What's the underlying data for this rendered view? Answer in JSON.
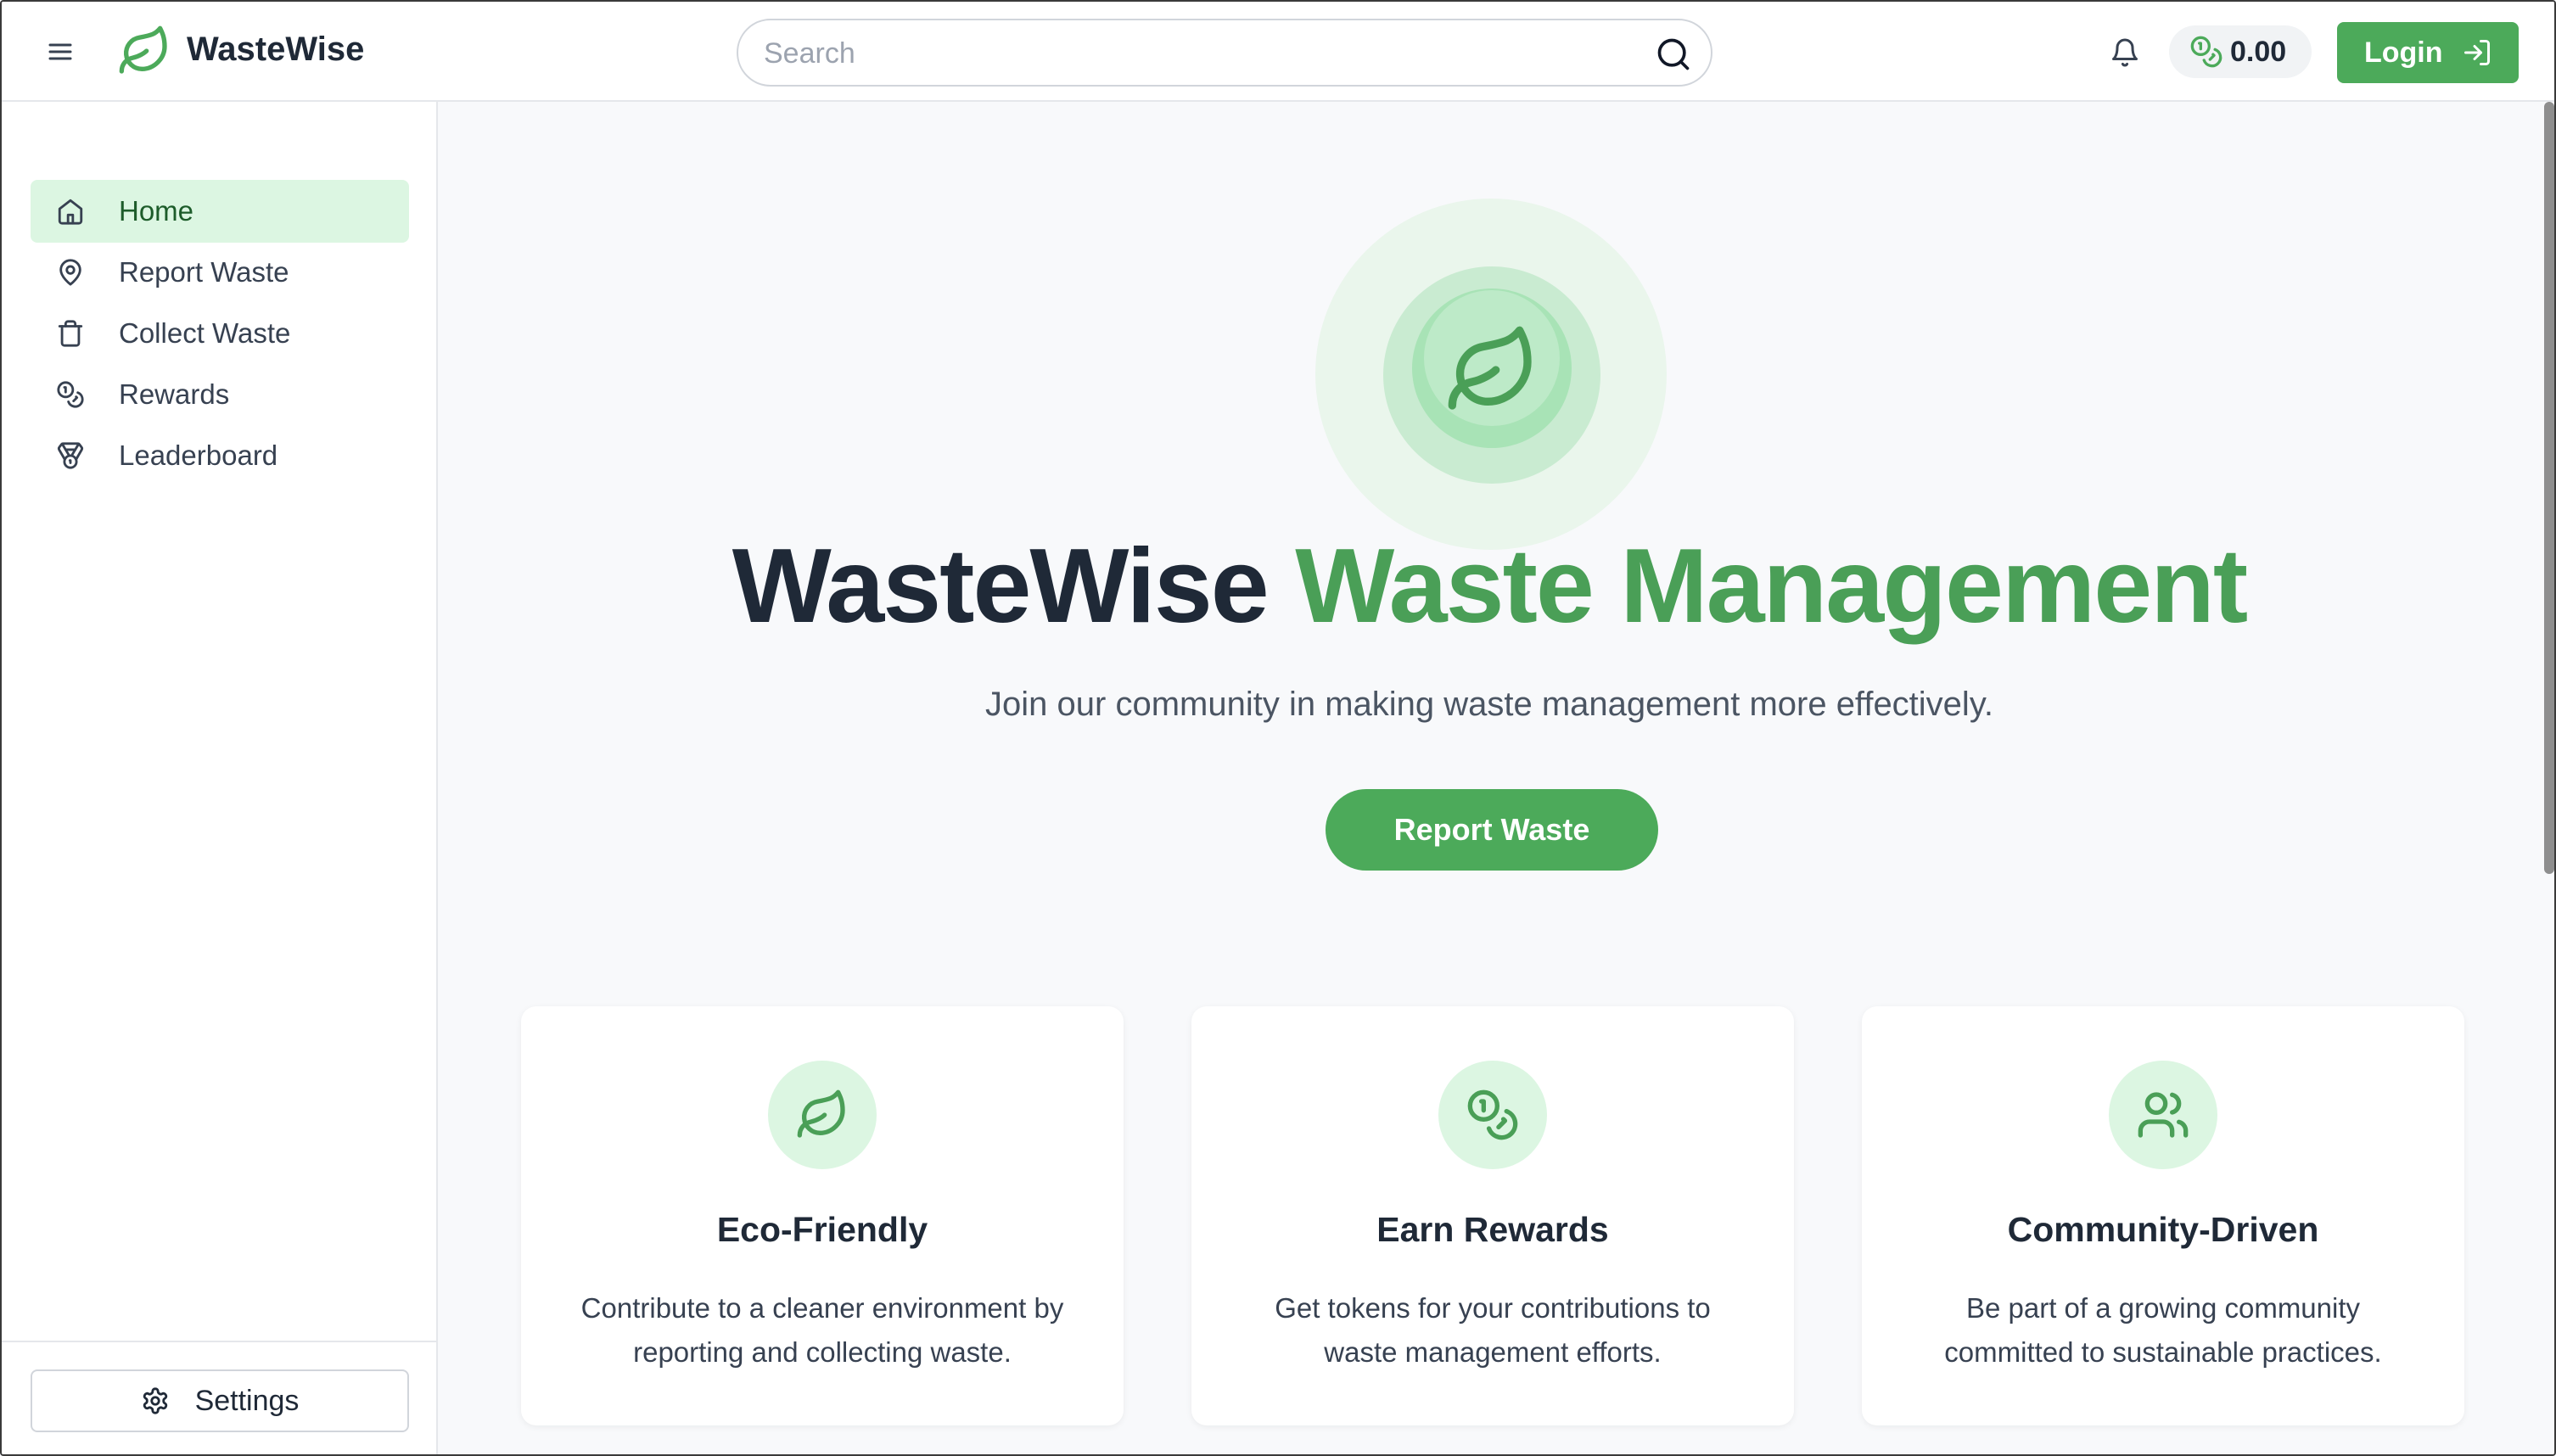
{
  "header": {
    "brand": "WasteWise",
    "search_placeholder": "Search",
    "balance": "0.00",
    "login_label": "Login"
  },
  "sidebar": {
    "items": [
      {
        "label": "Home",
        "icon": "home-icon",
        "active": true
      },
      {
        "label": "Report Waste",
        "icon": "map-pin-icon",
        "active": false
      },
      {
        "label": "Collect Waste",
        "icon": "trash-icon",
        "active": false
      },
      {
        "label": "Rewards",
        "icon": "coins-icon",
        "active": false
      },
      {
        "label": "Leaderboard",
        "icon": "medal-icon",
        "active": false
      }
    ],
    "settings_label": "Settings"
  },
  "hero": {
    "title_main": "WasteWise",
    "title_accent": "Waste Management",
    "subtitle": "Join our community in making waste management more effectively.",
    "cta_label": "Report Waste"
  },
  "features": [
    {
      "icon": "leaf-icon",
      "title": "Eco-Friendly",
      "description": "Contribute to a cleaner environment by reporting and collecting waste."
    },
    {
      "icon": "coins-icon",
      "title": "Earn Rewards",
      "description": "Get tokens for your contributions to waste management efforts."
    },
    {
      "icon": "users-icon",
      "title": "Community-Driven",
      "description": "Be part of a growing community committed to sustainable practices."
    }
  ],
  "colors": {
    "accent": "#4caa5a",
    "accent_text": "#4a9f57",
    "active_nav_bg": "#dcf6e2"
  }
}
